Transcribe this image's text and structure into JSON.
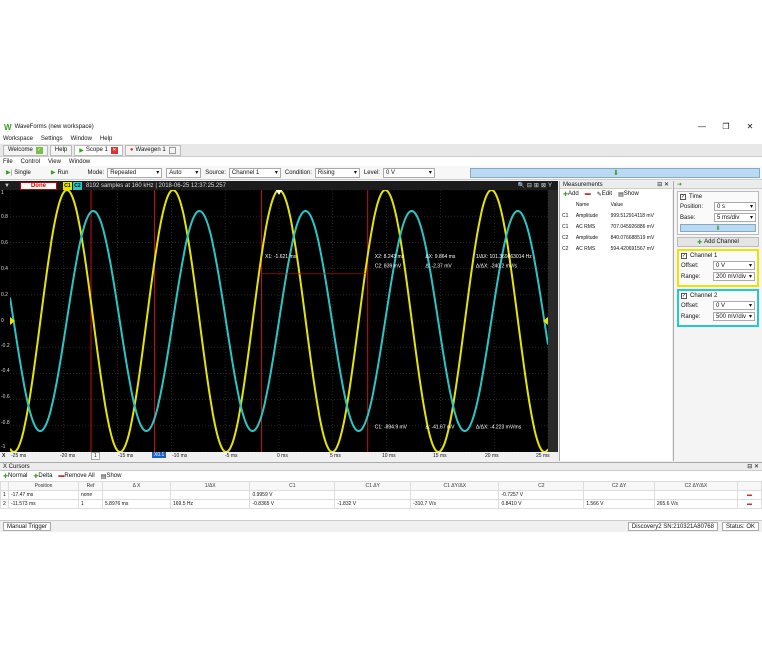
{
  "app": {
    "title": "WaveForms  (new workspace)"
  },
  "menu": [
    "Workspace",
    "Settings",
    "Window",
    "Help"
  ],
  "tabs": [
    {
      "label": "Welcome"
    },
    {
      "label": "Help"
    },
    {
      "label": "Scope 1"
    },
    {
      "label": "Wavegen 1"
    }
  ],
  "submenu": [
    "File",
    "Control",
    "View",
    "Window"
  ],
  "toolbar": {
    "single": "Single",
    "run": "Run",
    "mode_label": "Mode:",
    "mode": "Repeated",
    "auto": "Auto",
    "source_label": "Source:",
    "source": "Channel 1",
    "condition_label": "Condition:",
    "condition": "Rising",
    "level_label": "Level:",
    "level": "0 V"
  },
  "scope": {
    "status": "Done",
    "ch1": "C1",
    "ch2": "C2",
    "info": "8192 samples at 160 kHz | 2018-06-25 12:37:25.257",
    "cursor_x1": "X1: -1.621 ms",
    "cursor_x2_time": "X2: 8.243 ms",
    "cursor_x2_c2": "C2: 839 mV",
    "dx": "ΔX: 9.864 ms",
    "dy": "Δ: -2.37 mV",
    "inv_dx": "1/ΔX: 101.369863014 Hz",
    "dy_dx": "Δ/ΔX: -240.2 mV/s",
    "c1_low": "C1: -894.9 mV",
    "d_low": "Δ: -41.67 mV",
    "ddx_low": "Δ/ΔX: -4.223 mV/ms",
    "y_ticks": [
      "1",
      "0.8",
      "0.6",
      "0.4",
      "0.2",
      "0",
      "-0.2",
      "-0.4",
      "-0.6",
      "-0.8",
      "-1"
    ],
    "x_ticks": [
      "-25 ms",
      "-20 ms",
      "-15 ms",
      "-10 ms",
      "-5 ms",
      "0 ms",
      "5 ms",
      "10 ms",
      "15 ms",
      "20 ms",
      "25 ms"
    ],
    "x_prefix": "X",
    "x_mode_pre": "1",
    "x_mode": "X0.1",
    "colors": {
      "ch1": "#e5e500",
      "ch2": "#2ac6c6",
      "cursor": "#cc1111",
      "grid": "#3a3a3a"
    }
  },
  "chart_data": {
    "type": "line",
    "xlabel": "",
    "ylabel": "",
    "xlim": [
      -25,
      25
    ],
    "ylim": [
      -1,
      1
    ],
    "series": [
      {
        "name": "C1",
        "amplitude": 1.0,
        "frequency_hz": 101.37,
        "phase_ms": -2.45
      },
      {
        "name": "C2",
        "amplitude": 0.84,
        "frequency_hz": 101.37,
        "phase_ms": 0.0
      }
    ],
    "x_cursors_ms": [
      -17.47,
      -11.573,
      -1.621,
      8.243
    ]
  },
  "measurements": {
    "title": "Measurements",
    "toolbar": {
      "add": "Add",
      "edit": "Edit",
      "show": "Show"
    },
    "headers": [
      "Name",
      "Value"
    ],
    "rows": [
      {
        "ch": "C1",
        "name": "Amplitude",
        "value": "999.512914118 mV"
      },
      {
        "ch": "C1",
        "name": "AC RMS",
        "value": "707.045926886 mV"
      },
      {
        "ch": "C2",
        "name": "Amplitude",
        "value": "840.076688519 mV"
      },
      {
        "ch": "C2",
        "name": "AC RMS",
        "value": "594.420691567 mV"
      }
    ]
  },
  "time": {
    "title": "Time",
    "position_label": "Position:",
    "position": "0 s",
    "base_label": "Base:",
    "base": "5 ms/div"
  },
  "add_channel": "Add Channel",
  "channel1": {
    "title": "Channel 1",
    "offset_label": "Offset:",
    "offset": "0 V",
    "range_label": "Range:",
    "range": "200 mV/div"
  },
  "channel2": {
    "title": "Channel 2",
    "offset_label": "Offset:",
    "offset": "0 V",
    "range_label": "Range:",
    "range": "500 mV/div"
  },
  "cursors": {
    "title": "X Cursors",
    "toolbar": {
      "normal": "Normal",
      "delta": "Delta",
      "remove": "Remove All",
      "show": "Show"
    },
    "headers": [
      "Position",
      "Ref",
      "Δ X",
      "1/ΔX",
      "C1",
      "C1 ΔY",
      "C1 ΔY/ΔX",
      "C2",
      "C2 ΔY",
      "C2 ΔY/ΔX"
    ],
    "rows": [
      {
        "n": "1",
        "position": "-17.47 ms",
        "ref": "none",
        "dx": "",
        "inv": "",
        "c1": "0.9959 V",
        "c1dy": "",
        "c1dydx": "",
        "c2": "-0.7257 V",
        "c2dy": "",
        "c2dydx": ""
      },
      {
        "n": "2",
        "position": "-11.573 ms",
        "ref": "1",
        "dx": "5.8976 ms",
        "inv": "169.5 Hz",
        "c1": "-0.8365 V",
        "c1dy": "-1.832 V",
        "c1dydx": "-310.7 V/s",
        "c2": "0.8410 V",
        "c2dy": "1.566 V",
        "c2dydx": "265.6 V/s"
      }
    ]
  },
  "status": {
    "trigger": "Manual Trigger",
    "device": "Discovery2 SN:210321A80768",
    "state": "Status: OK"
  }
}
